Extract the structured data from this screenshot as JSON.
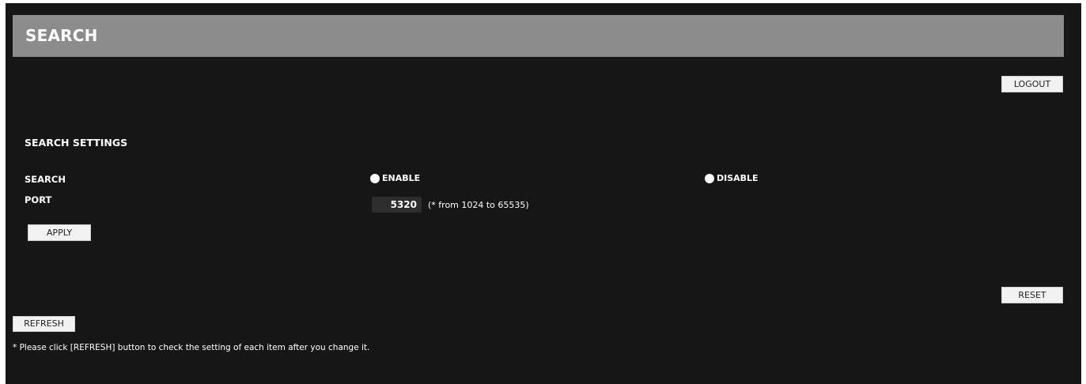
{
  "header": {
    "title": "SEARCH"
  },
  "toolbar": {
    "logout_label": "LOGOUT",
    "reset_label": "RESET",
    "refresh_label": "REFRESH"
  },
  "settings": {
    "section_title": "SEARCH SETTINGS",
    "search_label": "SEARCH",
    "enable_label": "ENABLE",
    "disable_label": "DISABLE",
    "port_label": "PORT",
    "port_value": "5320",
    "port_hint": "(* from 1024 to 65535)",
    "apply_label": "APPLY"
  },
  "footer": {
    "note": "* Please click [REFRESH] button to check the setting of each item after you change it."
  },
  "colors": {
    "background": "#161616",
    "header_bar": "#8c8c8c",
    "button": "#f2f2f2",
    "text": "#ffffff"
  }
}
